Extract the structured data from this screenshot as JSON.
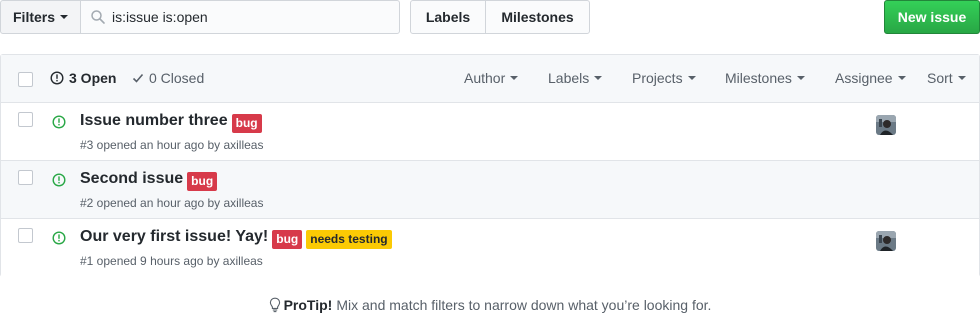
{
  "toolbar": {
    "filters_label": "Filters",
    "search_value": "is:issue is:open",
    "labels_label": "Labels",
    "milestones_label": "Milestones",
    "new_issue_label": "New issue"
  },
  "header": {
    "open_label": "3 Open",
    "closed_label": "0 Closed",
    "filters": [
      "Author",
      "Labels",
      "Projects",
      "Milestones",
      "Assignee",
      "Sort"
    ]
  },
  "issues": [
    {
      "title": "Issue number three",
      "labels": [
        "bug"
      ],
      "meta": "#3 opened an hour ago by axilleas",
      "has_assignee": true
    },
    {
      "title": "Second issue",
      "labels": [
        "bug"
      ],
      "meta": "#2 opened an hour ago by axilleas",
      "has_assignee": false
    },
    {
      "title": "Our very first issue! Yay!",
      "labels": [
        "bug",
        "needs testing"
      ],
      "meta": "#1 opened 9 hours ago by axilleas",
      "has_assignee": true
    }
  ],
  "protip": {
    "strong": "ProTip!",
    "text": "Mix and match filters to narrow down what you’re looking for."
  },
  "colors": {
    "green": "#28a745",
    "bug": "#d73a4a",
    "needs_testing": "#fbca04"
  }
}
